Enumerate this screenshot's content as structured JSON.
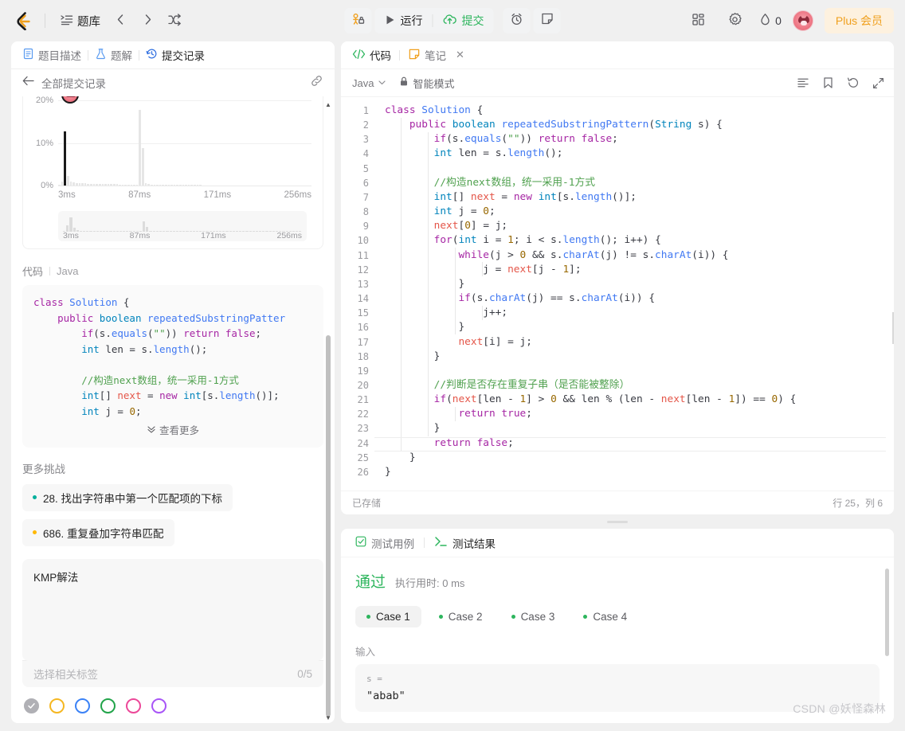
{
  "topbar": {
    "logo_icon": "leetcode-logo-icon",
    "problemset_icon": "list-icon",
    "problemset_label": "题库",
    "prev_icon": "chevron-left-icon",
    "next_icon": "chevron-right-icon",
    "shuffle_icon": "shuffle-icon",
    "debug_icon": "debug-lock-icon",
    "run_icon": "play-icon",
    "run_label": "运行",
    "submit_icon": "cloud-upload-icon",
    "submit_label": "提交",
    "timer_icon": "alarm-clock-icon",
    "note_icon": "note-icon",
    "grid_icon": "grid-apps-icon",
    "settings_icon": "gear-icon",
    "coin_icon": "water-drop-icon",
    "coin_count": "0",
    "avatar_icon": "user-avatar",
    "plus_label": "Plus 会员",
    "submit_color": "#2db55d",
    "plus_color": "#f0a01e"
  },
  "left_panel": {
    "tabs": [
      {
        "label": "题目描述",
        "icon": "document-icon",
        "active": false
      },
      {
        "label": "题解",
        "icon": "flask-icon",
        "active": false
      },
      {
        "label": "提交记录",
        "icon": "history-clock-icon",
        "active": true
      }
    ],
    "sub_header": {
      "back_icon": "arrow-left-icon",
      "title": "全部提交记录",
      "link_icon": "link-icon"
    },
    "chart_section": {
      "y_labels": [
        "20%",
        "10%",
        "0%"
      ],
      "x_labels": [
        "3ms",
        "87ms",
        "171ms",
        "256ms"
      ],
      "minimap_x_labels": [
        "3ms",
        "87ms",
        "171ms",
        "256ms"
      ]
    },
    "code_section": {
      "label": "代码",
      "language": "Java",
      "lines": [
        "class Solution {",
        "    public boolean repeatedSubstringPatter",
        "        if(s.equals(\"\")) return false;",
        "        int len = s.length();",
        "",
        "        //构造next数组，统一采用-1方式",
        "        int[] next = new int[s.length()];",
        "        int j = 0;"
      ],
      "more_label": "查看更多",
      "more_icon": "chevron-double-down-icon"
    },
    "challenges": {
      "title": "更多挑战",
      "items": [
        {
          "label": "28. 找出字符串中第一个匹配项的下标",
          "dot_color": "#00af9b"
        },
        {
          "label": "686. 重复叠加字符串匹配",
          "dot_color": "#ffb800"
        }
      ]
    },
    "note": {
      "text": "KMP解法",
      "tag_placeholder": "选择相关标签",
      "tag_count": "0/5",
      "swatches": [
        {
          "name": "gray",
          "color": "#b0b0b5",
          "selected": true
        },
        {
          "name": "yellow",
          "color": "#f5b721",
          "selected": false
        },
        {
          "name": "blue",
          "color": "#3b82f6",
          "selected": false
        },
        {
          "name": "green",
          "color": "#22a44a",
          "selected": false
        },
        {
          "name": "pink",
          "color": "#ec4899",
          "selected": false
        },
        {
          "name": "purple",
          "color": "#a855f7",
          "selected": false
        }
      ],
      "check_icon": "check-icon"
    }
  },
  "editor": {
    "tabs": [
      {
        "label": "代码",
        "icon": "code-icon",
        "active": true,
        "closable": false
      },
      {
        "label": "笔记",
        "icon": "note-icon",
        "active": false,
        "closable": true
      }
    ],
    "close_icon": "close-icon",
    "language": "Java",
    "language_caret_icon": "chevron-down-icon",
    "smart_mode_icon": "lock-icon",
    "smart_mode_label": "智能模式",
    "toolbar_icons": [
      "format-icon",
      "bookmark-icon",
      "reset-icon",
      "fullscreen-icon"
    ],
    "code_lines": [
      "class Solution {",
      "    public boolean repeatedSubstringPattern(String s) {",
      "        if(s.equals(\"\")) return false;",
      "        int len = s.length();",
      "",
      "        //构造next数组，统一采用-1方式",
      "        int[] next = new int[s.length()];",
      "        int j = 0;",
      "        next[0] = j;",
      "        for(int i = 1; i < s.length(); i++) {",
      "            while(j > 0 && s.charAt(j) != s.charAt(i)) {",
      "                j = next[j - 1];",
      "            }",
      "            if(s.charAt(j) == s.charAt(i)) {",
      "                j++;",
      "            }",
      "            next[i] = j;",
      "        }",
      "",
      "        //判断是否存在重复子串（是否能被整除）",
      "        if(next[len - 1] > 0 && len % (len - next[len - 1]) == 0) {",
      "            return true;",
      "        }",
      "        return false;",
      "    }",
      "}"
    ],
    "status_left": "已存储",
    "status_right": "行 25，列 6"
  },
  "results": {
    "tabs": [
      {
        "label": "测试用例",
        "icon": "checkbox-icon",
        "active": false
      },
      {
        "label": "测试结果",
        "icon": "terminal-icon",
        "active": true
      }
    ],
    "verdict": "通过",
    "runtime_label": "执行用时: 0 ms",
    "cases": [
      {
        "label": "Case 1",
        "active": true
      },
      {
        "label": "Case 2",
        "active": false
      },
      {
        "label": "Case 3",
        "active": false
      },
      {
        "label": "Case 4",
        "active": false
      }
    ],
    "input_label": "输入",
    "input_key": "s =",
    "input_value": "\"abab\""
  },
  "watermark": "CSDN @妖怪森林",
  "chart_data": {
    "type": "bar",
    "title": "",
    "xlabel": "",
    "ylabel": "",
    "categories": [
      "3ms",
      "87ms",
      "171ms",
      "256ms"
    ],
    "ylim": [
      0,
      22
    ],
    "y_ticks": [
      0,
      10,
      20
    ],
    "y_tick_labels": [
      "0%",
      "10%",
      "20%"
    ],
    "grid": true,
    "legend": "none",
    "highlight_bar_index": 2,
    "highlight_value": 14,
    "values": [
      0.4,
      1.2,
      14,
      2.6,
      1.3,
      1.0,
      0.9,
      0.9,
      0.8,
      0.8,
      0.7,
      0.7,
      0.7,
      0.7,
      0.6,
      0.6,
      0.6,
      0.6,
      0.6,
      0.6,
      0.6,
      0.5,
      0.5,
      0.5,
      0.5,
      0.5,
      0.5,
      0.5,
      19.5,
      9.8,
      0.8,
      0.6,
      0.5,
      0.5,
      0.5,
      0.5,
      0.4,
      0.4,
      0.4,
      0.4,
      0.4,
      0.4,
      0.4,
      0.4,
      0.4,
      0.4,
      0.4,
      0.4,
      0.4,
      0.4,
      0.3,
      0.3,
      0.3,
      0.3,
      0.3,
      0.3,
      0.3,
      0.3,
      0.3,
      0.3,
      0.3,
      0.3,
      0.3,
      0.3,
      0.3,
      0.3,
      0.3,
      0.3,
      0.3,
      0.3,
      0.3,
      0.3,
      0.3,
      0.3,
      0.3,
      0.3,
      0.3,
      0.3,
      0.2,
      0.2,
      0.2,
      0.2,
      0.2,
      0.2,
      0.2,
      0.2,
      0.2,
      0.2
    ],
    "minimap_values": [
      0.6,
      3.2,
      7.5,
      2.0,
      0.8,
      0.6,
      0.5,
      0.5,
      0.5,
      0.4,
      0.4,
      0.4,
      0.4,
      0.4,
      0.4,
      0.4,
      0.4,
      0.4,
      0.4,
      0.4,
      0.4,
      0.4,
      0.4,
      0.4,
      5.5,
      2.4,
      0.5,
      0.4,
      0.4,
      0.4,
      0.4,
      0.4,
      0.4,
      0.4,
      0.4,
      0.4,
      0.4,
      0.4,
      0.4,
      0.4,
      0.4,
      0.4,
      0.4,
      0.4,
      0.4,
      0.4,
      0.4,
      0.4,
      0.4,
      0.4,
      0.4,
      0.4,
      0.4,
      0.4,
      0.4,
      0.4,
      0.4,
      0.4,
      0.4,
      0.4,
      0.4,
      0.4,
      0.4,
      0.4,
      0.4,
      0.4,
      0.4,
      0.4,
      0.4,
      0.4,
      0.4,
      0.4
    ]
  }
}
